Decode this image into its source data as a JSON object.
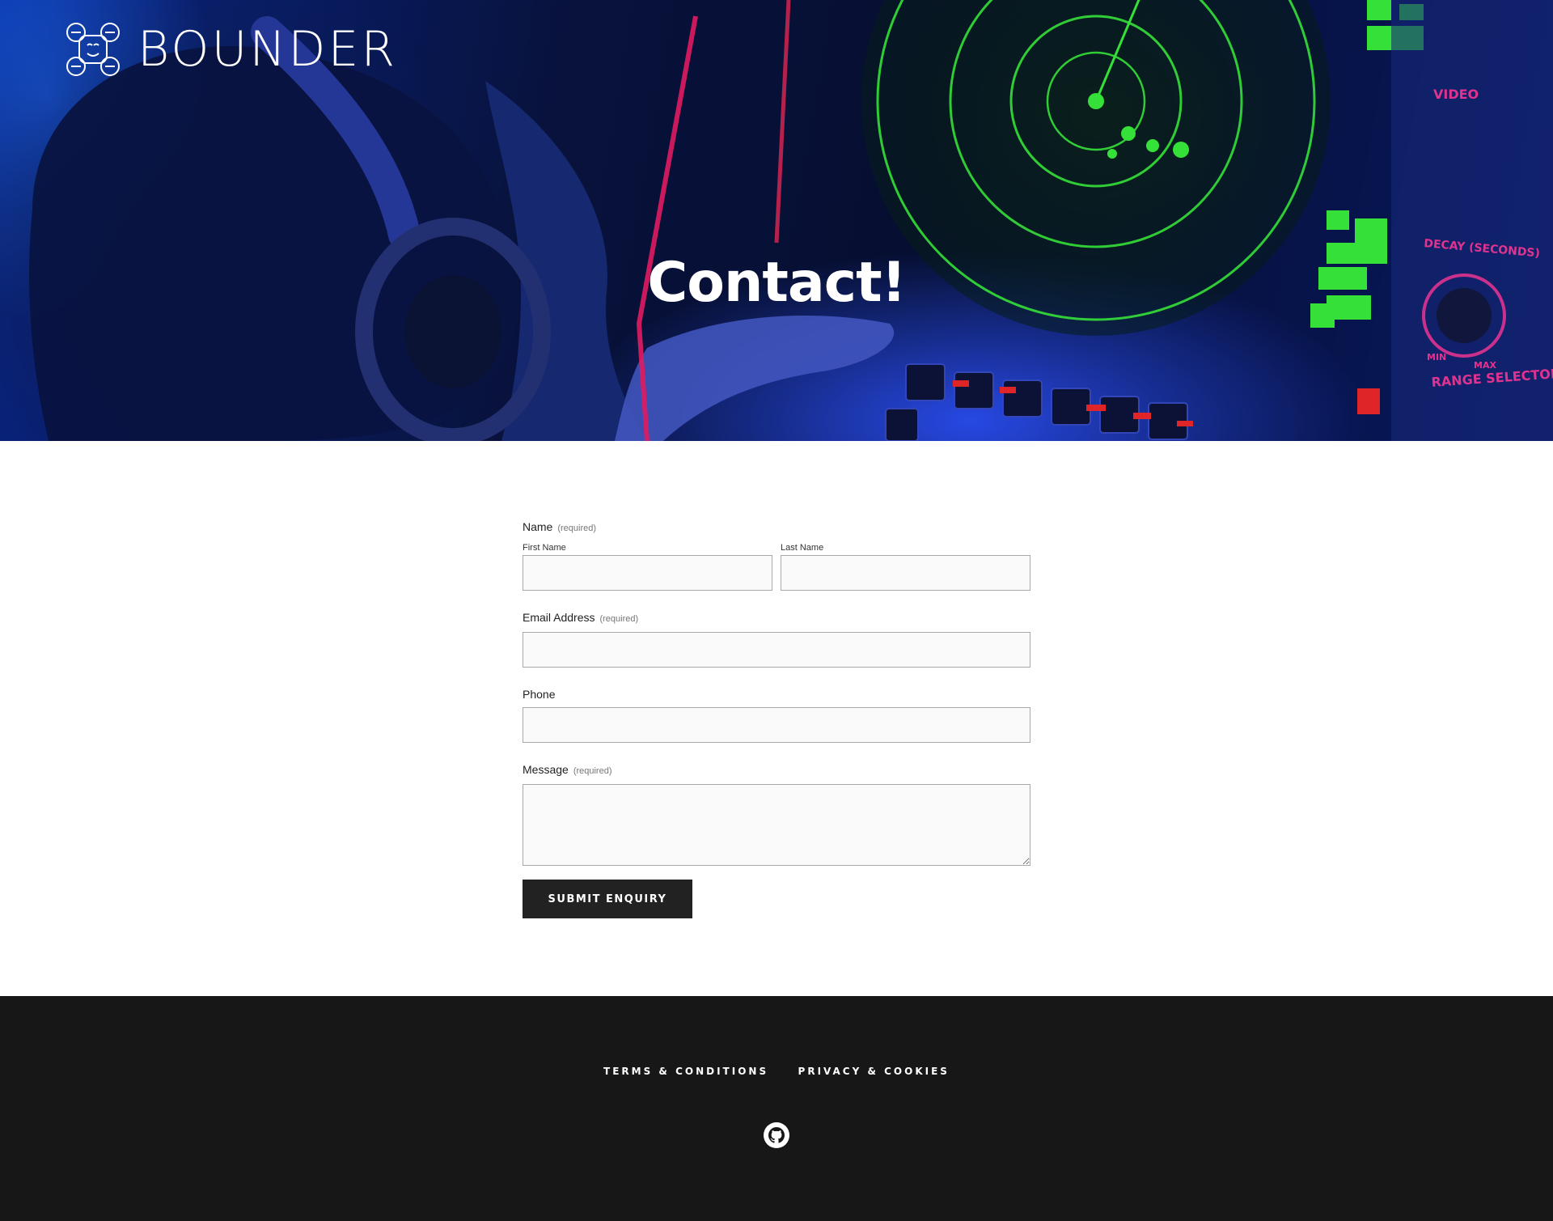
{
  "brand": {
    "name": "BOUNDER",
    "icon": "drone-logo-icon"
  },
  "hero": {
    "title": "Contact!",
    "image": "radar-operator-photo",
    "image_texts": [
      "VIDEO",
      "DECAY (SECONDS)",
      "RANGE SELECTOR",
      "MIN",
      "MAX"
    ]
  },
  "form": {
    "name_label": "Name",
    "name_required": "(required)",
    "first_name_label": "First Name",
    "first_name_value": "",
    "last_name_label": "Last Name",
    "last_name_value": "",
    "email_label": "Email Address",
    "email_required": "(required)",
    "email_value": "",
    "phone_label": "Phone",
    "phone_value": "",
    "message_label": "Message",
    "message_required": "(required)",
    "message_value": "",
    "submit_label": "SUBMIT ENQUIRY"
  },
  "footer": {
    "links": [
      "TERMS & CONDITIONS",
      "PRIVACY & COOKIES"
    ],
    "social_icon": "github-icon"
  },
  "colors": {
    "button_bg": "#222222",
    "footer_bg": "#171717",
    "input_bg": "#fafafa",
    "radar_green": "#3dff3d",
    "hero_blue": "#1a3cff"
  }
}
